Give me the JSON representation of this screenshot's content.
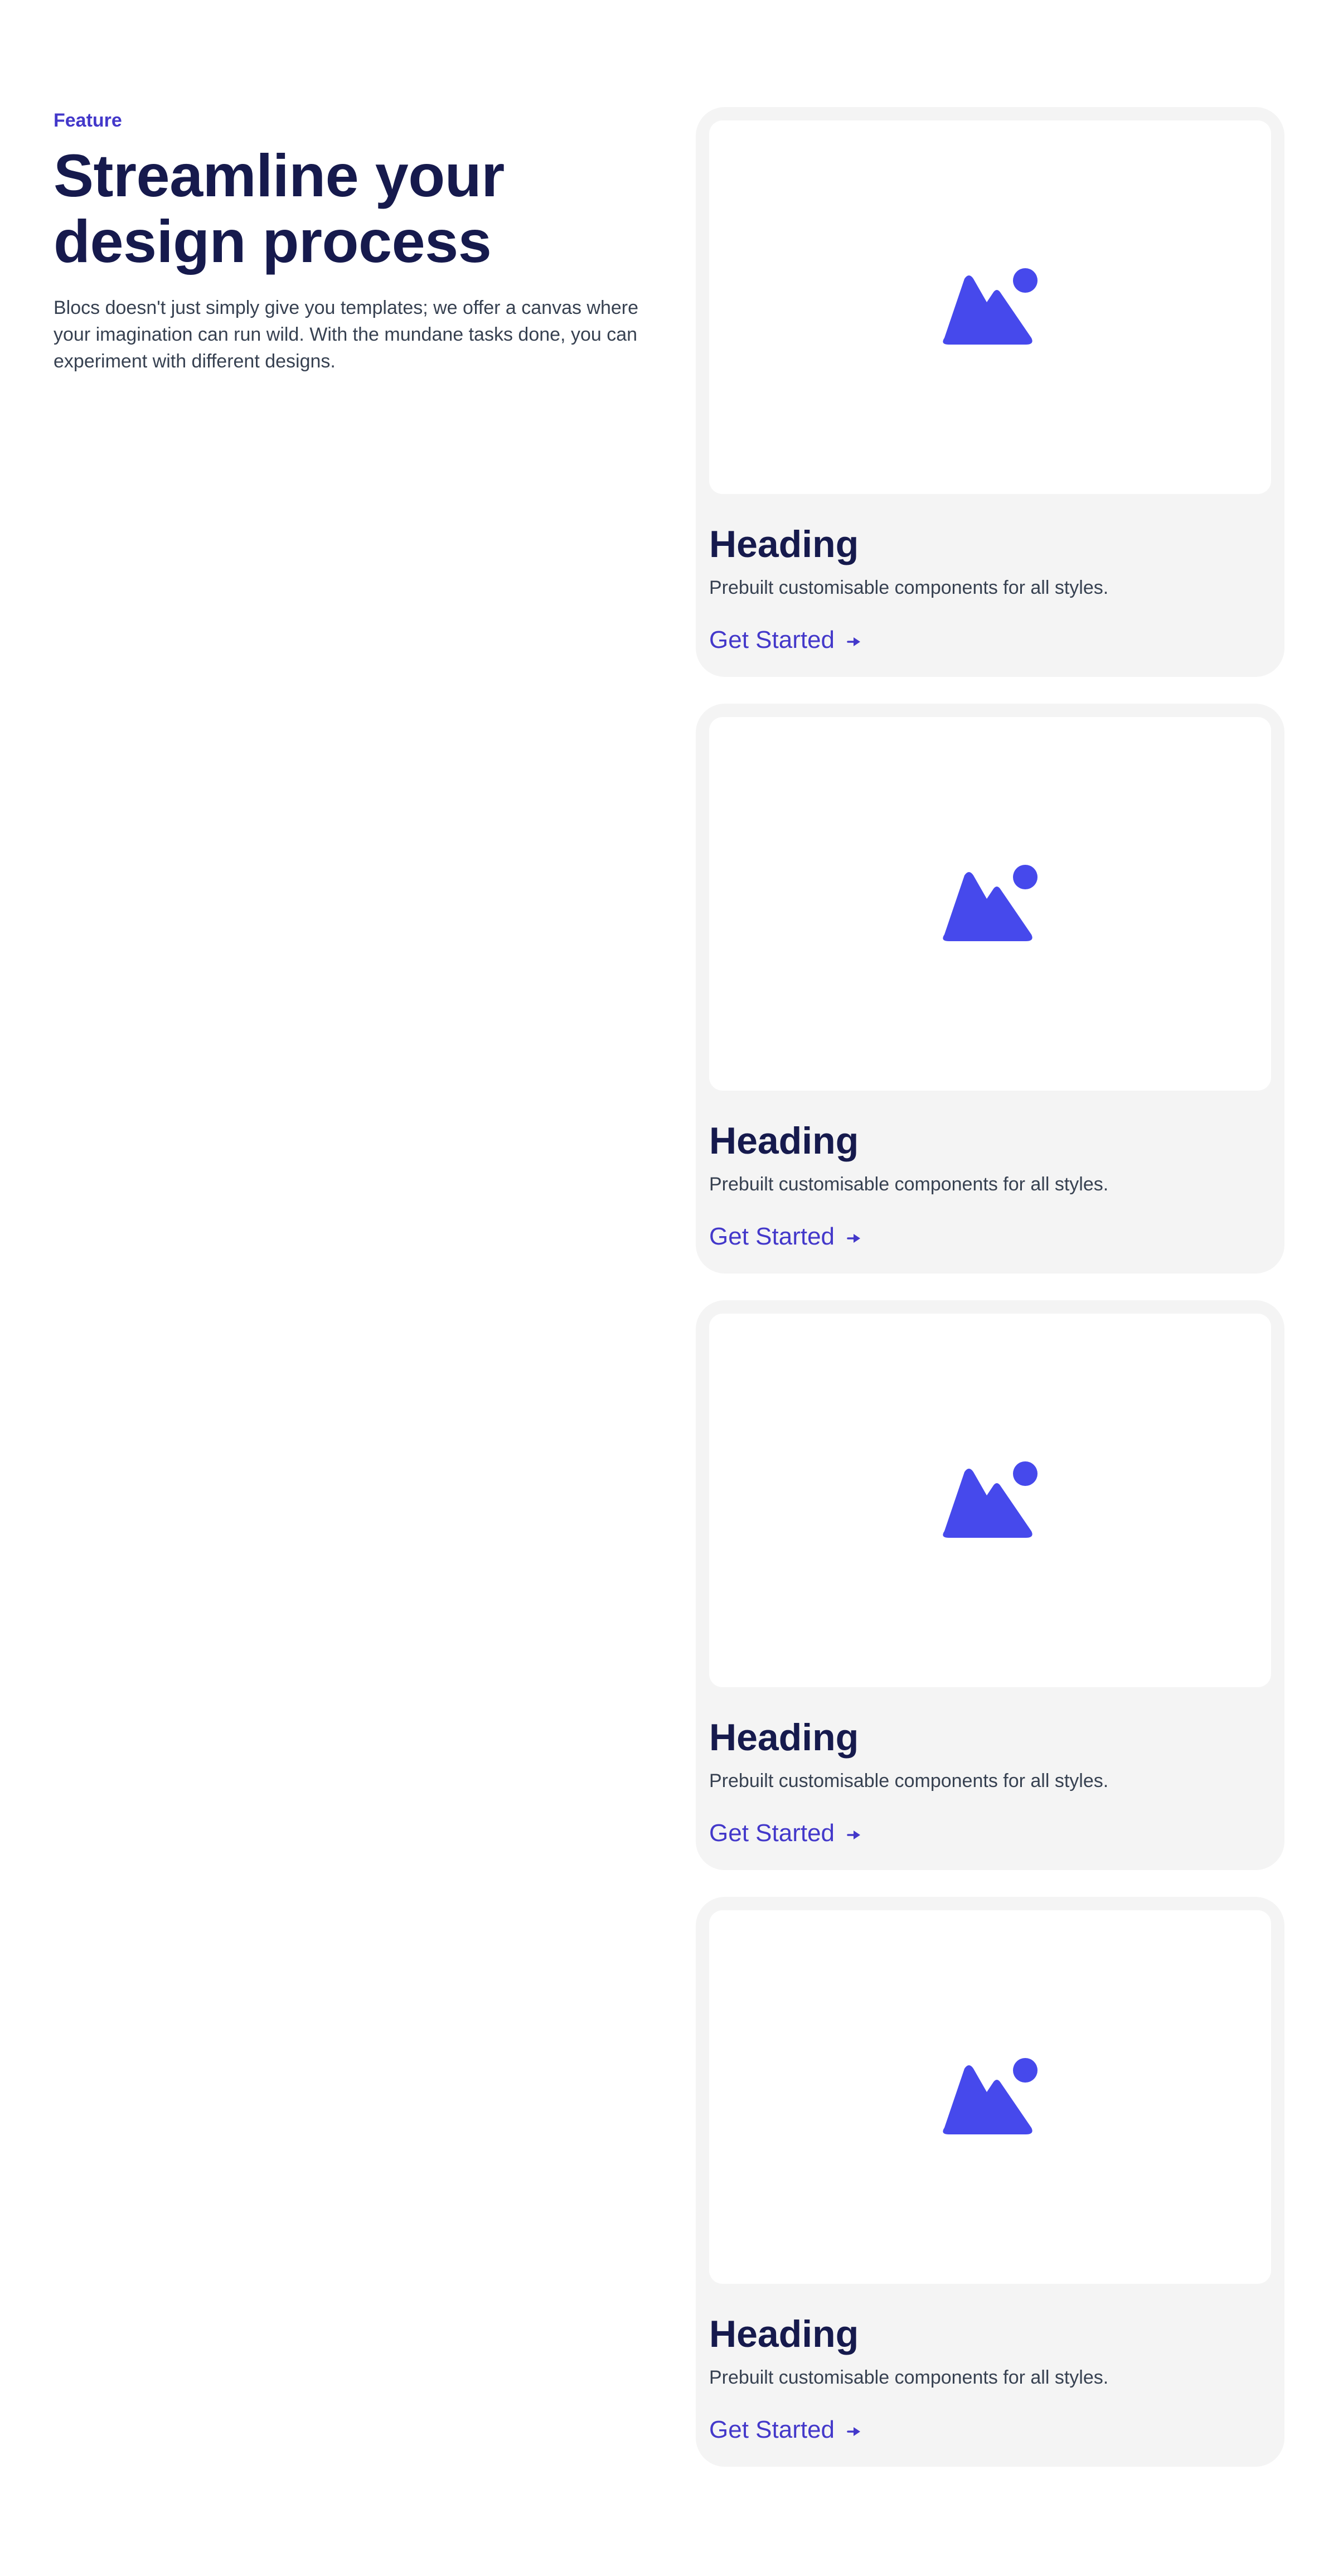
{
  "intro": {
    "eyebrow": "Feature",
    "title_line1": "Streamline your",
    "title_line2": "design process",
    "description": "Blocs doesn't just simply give you templates; we offer a canvas where your imagination can run wild. With the mundane tasks done, you can experiment with different designs."
  },
  "cards": [
    {
      "heading": "Heading",
      "text": "Prebuilt customisable components for all styles.",
      "link": "Get Started",
      "icon": "image-icon",
      "link_icon": "arrow-right-icon"
    },
    {
      "heading": "Heading",
      "text": "Prebuilt customisable components for all styles.",
      "link": "Get Started",
      "icon": "image-icon",
      "link_icon": "arrow-right-icon"
    },
    {
      "heading": "Heading",
      "text": "Prebuilt customisable components for all styles.",
      "link": "Get Started",
      "icon": "image-icon",
      "link_icon": "arrow-right-icon"
    },
    {
      "heading": "Heading",
      "text": "Prebuilt customisable components for all styles.",
      "link": "Get Started",
      "icon": "image-icon",
      "link_icon": "arrow-right-icon"
    }
  ],
  "colors": {
    "accent": "#4338ca",
    "icon": "#4649ec",
    "heading": "#161a4d",
    "body_text": "#374151",
    "card_background": "#f4f4f4",
    "page_background": "#ffffff"
  }
}
